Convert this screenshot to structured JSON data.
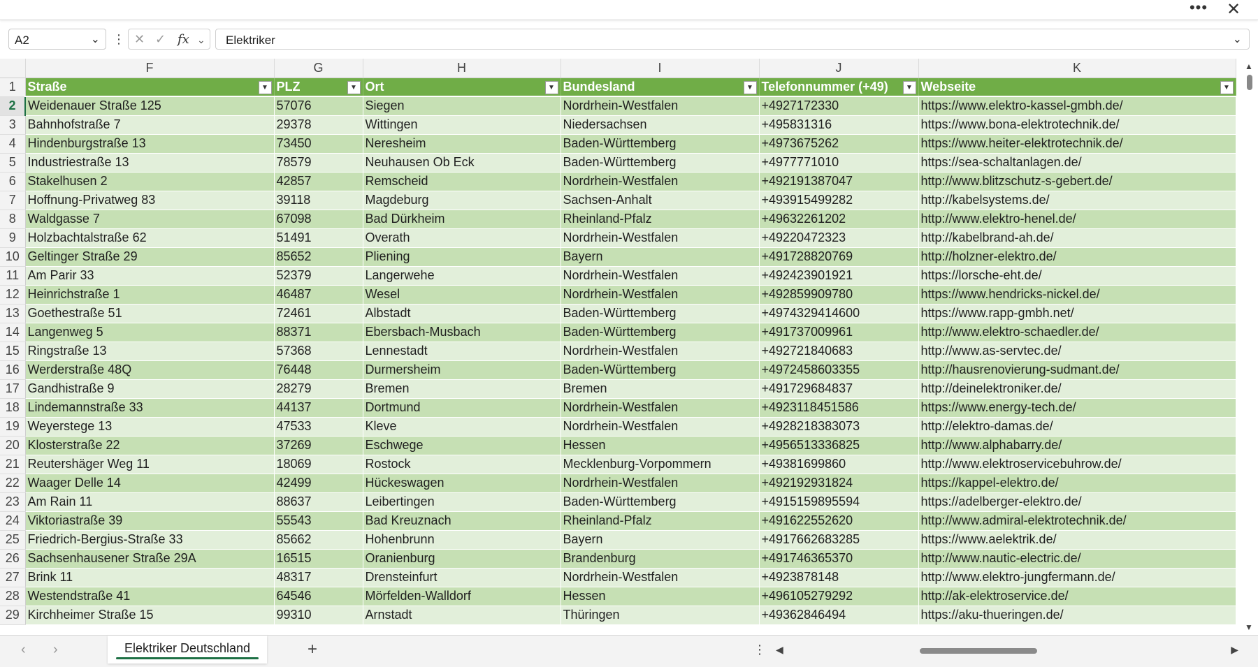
{
  "window": {
    "more_icon": "ellipsis-icon",
    "close_icon": "close-icon"
  },
  "formula_bar": {
    "name_box": "A2",
    "content": "Elektriker"
  },
  "columns": [
    "F",
    "G",
    "H",
    "I",
    "J",
    "K"
  ],
  "table": {
    "headers": [
      "Straße",
      "PLZ",
      "Ort",
      "Bundesland",
      "Telefonnummer (+49)",
      "Webseite"
    ],
    "rows": [
      {
        "n": "2",
        "c": [
          "Weidenauer Straße 125",
          "57076",
          "Siegen",
          "Nordrhein-Westfalen",
          "+4927172330",
          "https://www.elektro-kassel-gmbh.de/"
        ]
      },
      {
        "n": "3",
        "c": [
          "Bahnhofstraße 7",
          "29378",
          "Wittingen",
          "Niedersachsen",
          "+495831316",
          "https://www.bona-elektrotechnik.de/"
        ]
      },
      {
        "n": "4",
        "c": [
          "Hindenburgstraße 13",
          "73450",
          "Neresheim",
          "Baden-Württemberg",
          "+4973675262",
          "https://www.heiter-elektrotechnik.de/"
        ]
      },
      {
        "n": "5",
        "c": [
          "Industriestraße 13",
          "78579",
          "Neuhausen Ob Eck",
          "Baden-Württemberg",
          "+4977771010",
          "https://sea-schaltanlagen.de/"
        ]
      },
      {
        "n": "6",
        "c": [
          "Stakelhusen 2",
          "42857",
          "Remscheid",
          "Nordrhein-Westfalen",
          "+492191387047",
          "http://www.blitzschutz-s-gebert.de/"
        ]
      },
      {
        "n": "7",
        "c": [
          "Hoffnung-Privatweg 83",
          "39118",
          "Magdeburg",
          "Sachsen-Anhalt",
          "+493915499282",
          "http://kabelsystems.de/"
        ]
      },
      {
        "n": "8",
        "c": [
          "Waldgasse 7",
          "67098",
          "Bad Dürkheim",
          "Rheinland-Pfalz",
          "+49632261202",
          "http://www.elektro-henel.de/"
        ]
      },
      {
        "n": "9",
        "c": [
          "Holzbachtalstraße 62",
          "51491",
          "Overath",
          "Nordrhein-Westfalen",
          "+49220472323",
          "http://kabelbrand-ah.de/"
        ]
      },
      {
        "n": "10",
        "c": [
          "Geltinger Straße 29",
          "85652",
          "Pliening",
          "Bayern",
          "+491728820769",
          "http://holzner-elektro.de/"
        ]
      },
      {
        "n": "11",
        "c": [
          "Am Parir 33",
          "52379",
          "Langerwehe",
          "Nordrhein-Westfalen",
          "+492423901921",
          "https://lorsche-eht.de/"
        ]
      },
      {
        "n": "12",
        "c": [
          "Heinrichstraße 1",
          "46487",
          "Wesel",
          "Nordrhein-Westfalen",
          "+492859909780",
          "https://www.hendricks-nickel.de/"
        ]
      },
      {
        "n": "13",
        "c": [
          "Goethestraße 51",
          "72461",
          "Albstadt",
          "Baden-Württemberg",
          "+4974329414600",
          "https://www.rapp-gmbh.net/"
        ]
      },
      {
        "n": "14",
        "c": [
          "Langenweg 5",
          "88371",
          "Ebersbach-Musbach",
          "Baden-Württemberg",
          "+491737009961",
          "http://www.elektro-schaedler.de/"
        ]
      },
      {
        "n": "15",
        "c": [
          "Ringstraße 13",
          "57368",
          "Lennestadt",
          "Nordrhein-Westfalen",
          "+492721840683",
          "http://www.as-servtec.de/"
        ]
      },
      {
        "n": "16",
        "c": [
          "Werderstraße 48Q",
          "76448",
          "Durmersheim",
          "Baden-Württemberg",
          "+4972458603355",
          "http://hausrenovierung-sudmant.de/"
        ]
      },
      {
        "n": "17",
        "c": [
          "Gandhistraße 9",
          "28279",
          "Bremen",
          "Bremen",
          "+491729684837",
          "http://deinelektroniker.de/"
        ]
      },
      {
        "n": "18",
        "c": [
          "Lindemannstraße 33",
          "44137",
          "Dortmund",
          "Nordrhein-Westfalen",
          "+4923118451586",
          "https://www.energy-tech.de/"
        ]
      },
      {
        "n": "19",
        "c": [
          "Weyerstege 13",
          "47533",
          "Kleve",
          "Nordrhein-Westfalen",
          "+4928218383073",
          "http://elektro-damas.de/"
        ]
      },
      {
        "n": "20",
        "c": [
          "Klosterstraße 22",
          "37269",
          "Eschwege",
          "Hessen",
          "+4956513336825",
          "http://www.alphabarry.de/"
        ]
      },
      {
        "n": "21",
        "c": [
          "Reutershäger Weg 11",
          "18069",
          "Rostock",
          "Mecklenburg-Vorpommern",
          "+49381699860",
          "http://www.elektroservicebuhrow.de/"
        ]
      },
      {
        "n": "22",
        "c": [
          "Waager Delle 14",
          "42499",
          "Hückeswagen",
          "Nordrhein-Westfalen",
          "+492192931824",
          "https://kappel-elektro.de/"
        ]
      },
      {
        "n": "23",
        "c": [
          "Am Rain 11",
          "88637",
          "Leibertingen",
          "Baden-Württemberg",
          "+4915159895594",
          "https://adelberger-elektro.de/"
        ]
      },
      {
        "n": "24",
        "c": [
          "Viktoriastraße 39",
          "55543",
          "Bad Kreuznach",
          "Rheinland-Pfalz",
          "+491622552620",
          "http://www.admiral-elektrotechnik.de/"
        ]
      },
      {
        "n": "25",
        "c": [
          "Friedrich-Bergius-Straße 33",
          "85662",
          "Hohenbrunn",
          "Bayern",
          "+4917662683285",
          "https://www.aelektrik.de/"
        ]
      },
      {
        "n": "26",
        "c": [
          "Sachsenhausener Straße 29A",
          "16515",
          "Oranienburg",
          "Brandenburg",
          "+491746365370",
          "http://www.nautic-electric.de/"
        ]
      },
      {
        "n": "27",
        "c": [
          "Brink 11",
          "48317",
          "Drensteinfurt",
          "Nordrhein-Westfalen",
          "+4923878148",
          "http://www.elektro-jungfermann.de/"
        ]
      },
      {
        "n": "28",
        "c": [
          "Westendstraße 41",
          "64546",
          "Mörfelden-Walldorf",
          "Hessen",
          "+496105279292",
          "http://ak-elektroservice.de/"
        ]
      },
      {
        "n": "29",
        "c": [
          "Kirchheimer Straße 15",
          "99310",
          "Arnstadt",
          "Thüringen",
          "+49362846494",
          "https://aku-thueringen.de/"
        ]
      }
    ]
  },
  "sheet_tabs": {
    "active": "Elektriker Deutschland",
    "add_icon": "plus-icon"
  }
}
